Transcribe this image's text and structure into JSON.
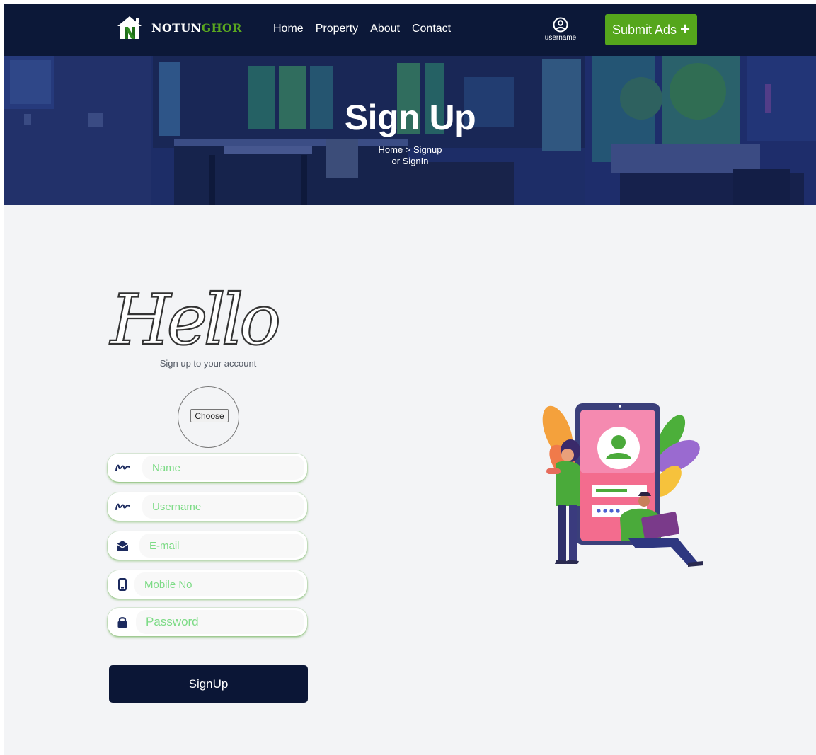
{
  "navbar": {
    "brand_part1": "NOTUN",
    "brand_part2": "GHOR",
    "links": [
      "Home",
      "Property",
      "About",
      "Contact"
    ],
    "user_label": "username",
    "submit_label": "Submit Ads",
    "submit_icon": "plus-icon",
    "colors": {
      "background": "#0c1838",
      "accent": "#55a61c"
    }
  },
  "hero": {
    "title": "Sign Up",
    "breadcrumb_line1": "Home > Signup",
    "breadcrumb_line2": "or SignIn"
  },
  "form": {
    "hello_text": "Hello",
    "subtitle": "Sign up to your account",
    "choose_label": "Choose",
    "fields": [
      {
        "icon": "signature-icon",
        "placeholder": "Name",
        "value": ""
      },
      {
        "icon": "signature-icon",
        "placeholder": "Username",
        "value": ""
      },
      {
        "icon": "envelope-open-icon",
        "placeholder": "E-mail",
        "value": ""
      },
      {
        "icon": "mobile-phone-icon",
        "placeholder": "Mobile No",
        "value": ""
      },
      {
        "icon": "lock-icon",
        "placeholder": "Password",
        "value": ""
      }
    ],
    "submit_label": "SignUp",
    "colors": {
      "placeholder": "#7ddb86",
      "button": "#0b1636"
    }
  }
}
